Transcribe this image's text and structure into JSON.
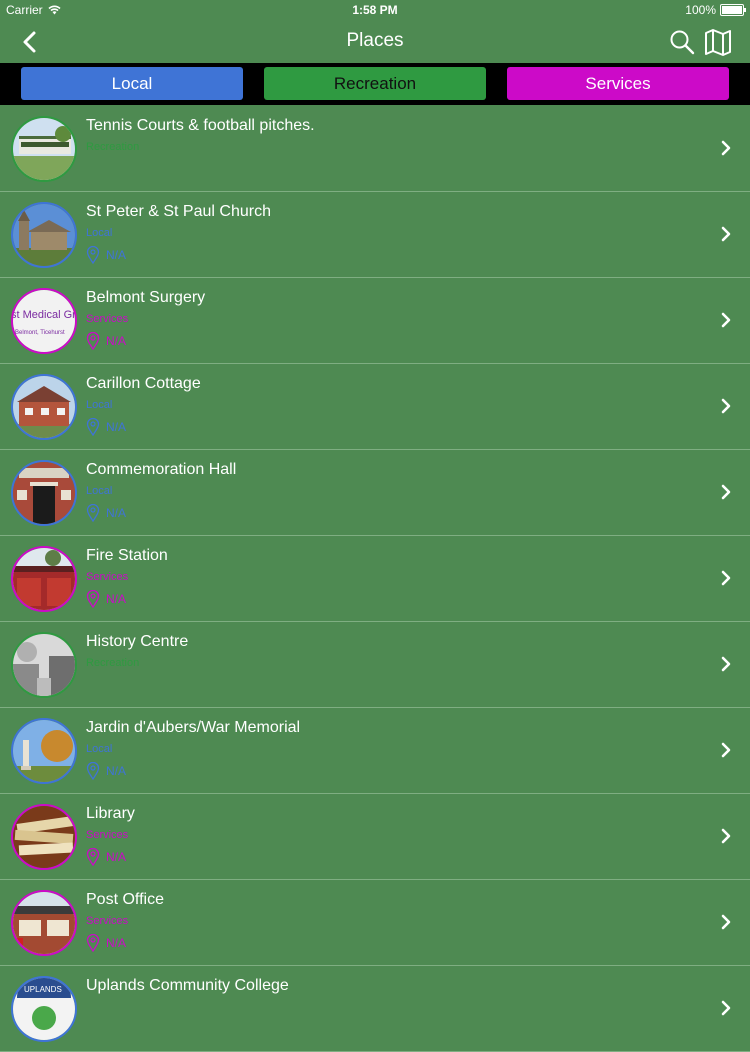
{
  "status_bar": {
    "carrier": "Carrier",
    "time": "1:58 PM",
    "battery": "100%"
  },
  "nav": {
    "title": "Places"
  },
  "segments": [
    {
      "label": "Local",
      "color": "#3f74d6"
    },
    {
      "label": "Recreation",
      "color": "#2f9a41"
    },
    {
      "label": "Services",
      "color": "#cc0ac8"
    }
  ],
  "places": [
    {
      "title": "Tennis Courts & football pitches.",
      "category": "Recreation",
      "category_color": "#2f9a41",
      "address": "",
      "thumb": "tennis"
    },
    {
      "title": "St Peter & St Paul Church",
      "category": "Local",
      "category_color": "#3f74d6",
      "address": "N/A",
      "thumb": "church"
    },
    {
      "title": "Belmont Surgery",
      "category": "Services",
      "category_color": "#cc0ac8",
      "address": "N/A",
      "thumb": "surgery"
    },
    {
      "title": "Carillon Cottage",
      "category": "Local",
      "category_color": "#3f74d6",
      "address": "N/A",
      "thumb": "cottage"
    },
    {
      "title": "Commemoration Hall",
      "category": "Local",
      "category_color": "#3f74d6",
      "address": "N/A",
      "thumb": "hall"
    },
    {
      "title": "Fire Station",
      "category": "Services",
      "category_color": "#cc0ac8",
      "address": "N/A",
      "thumb": "fire"
    },
    {
      "title": "History Centre",
      "category": "Recreation",
      "category_color": "#2f9a41",
      "address": "",
      "thumb": "history"
    },
    {
      "title": "Jardin d'Aubers/War Memorial",
      "category": "Local",
      "category_color": "#3f74d6",
      "address": "N/A",
      "thumb": "memorial"
    },
    {
      "title": "Library",
      "category": "Services",
      "category_color": "#cc0ac8",
      "address": "N/A",
      "thumb": "library"
    },
    {
      "title": "Post Office",
      "category": "Services",
      "category_color": "#cc0ac8",
      "address": "N/A",
      "thumb": "post"
    },
    {
      "title": "Uplands Community College",
      "category": "",
      "category_color": "#3f74d6",
      "address": "",
      "thumb": "college"
    }
  ]
}
